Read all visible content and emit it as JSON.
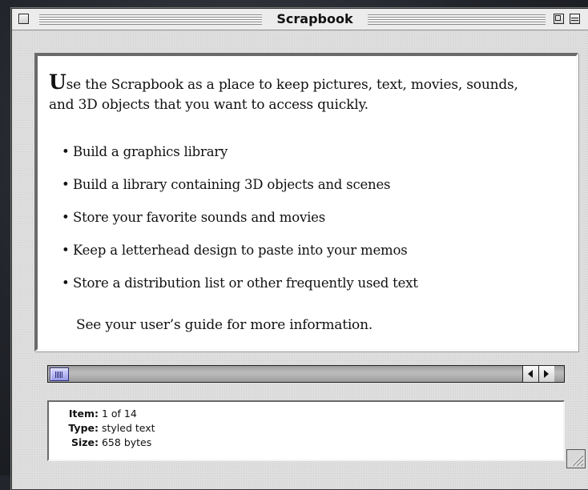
{
  "window": {
    "title": "Scrapbook"
  },
  "content": {
    "intro_initial": "U",
    "intro_rest": "se the Scrapbook as a place to keep pictures, text, movies, sounds, and 3D objects that you want to access quickly.",
    "bullets": [
      "Build a graphics library",
      "Build a library containing 3D objects and scenes",
      "Store your favorite sounds and movies",
      "Keep a letterhead design to paste into your memos",
      "Store a distribution list or other frequently used text"
    ],
    "footnote": "See your user’s guide for more information."
  },
  "info": {
    "item_label": "Item:",
    "item_value": "1 of 14",
    "type_label": "Type:",
    "type_value": "styled text",
    "size_label": "Size:",
    "size_value": "658 bytes"
  },
  "scrollbar": {
    "position": 0.0
  },
  "icons": {
    "close": "close-box-icon",
    "zoom": "zoom-box-icon",
    "collapse": "collapse-box-icon",
    "scroll_left": "left-arrow-icon",
    "scroll_right": "right-arrow-icon",
    "grow": "resize-grip-icon"
  },
  "colors": {
    "thumb": "#9a9ae6",
    "window_bg": "#dedede"
  }
}
